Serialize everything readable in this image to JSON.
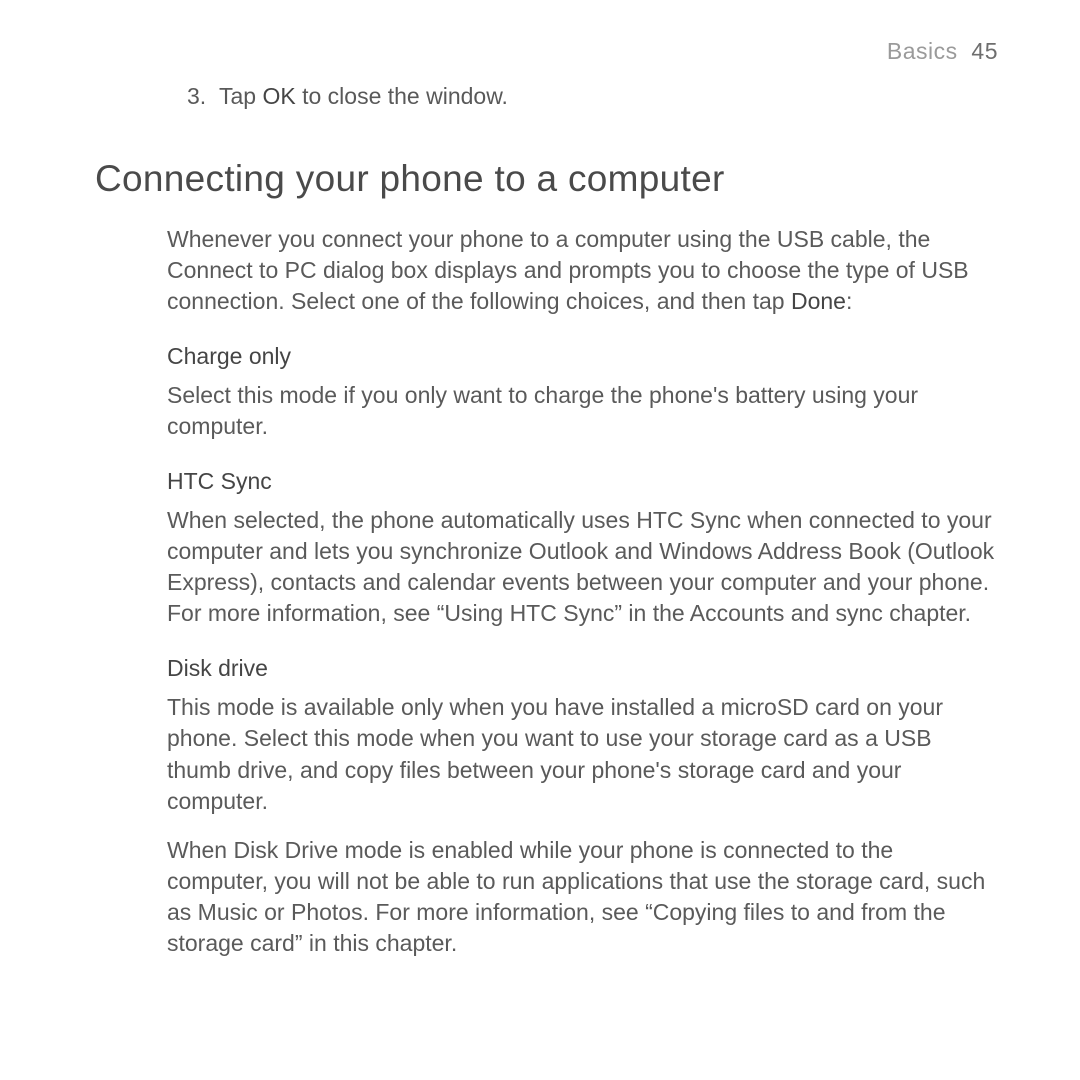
{
  "header": {
    "section": "Basics",
    "page": "45"
  },
  "step": {
    "num": "3.",
    "pre": "Tap ",
    "bold": "OK",
    "post": " to close the window."
  },
  "title": "Connecting your phone to a computer",
  "intro": {
    "pre": "Whenever you connect your phone to a computer using the USB cable, the Connect to PC dialog box displays and prompts you to choose the type of USB connection. Select one of the following choices, and then tap ",
    "bold": "Done",
    "post": ":"
  },
  "sections": {
    "charge": {
      "heading": "Charge only",
      "body": "Select this mode if you only want to charge the phone's battery using your computer."
    },
    "htcsync": {
      "heading": "HTC Sync",
      "body": "When selected, the phone automatically uses HTC Sync when connected to your computer and lets you synchronize Outlook and Windows Address Book (Outlook Express), contacts and calendar events between your computer and your phone. For more information, see “Using HTC Sync” in the Accounts and sync chapter."
    },
    "disk": {
      "heading": "Disk drive",
      "p1": "This mode is available only when you have installed a microSD card on your phone. Select this mode when you want to use your storage card as a USB thumb drive, and copy files between your phone's storage card and your computer.",
      "p2": "When Disk Drive mode is enabled while your phone is connected to the computer, you will not be able to run applications that use the storage card, such as Music or Photos. For more information, see “Copying files to and from the storage card” in this chapter."
    }
  }
}
